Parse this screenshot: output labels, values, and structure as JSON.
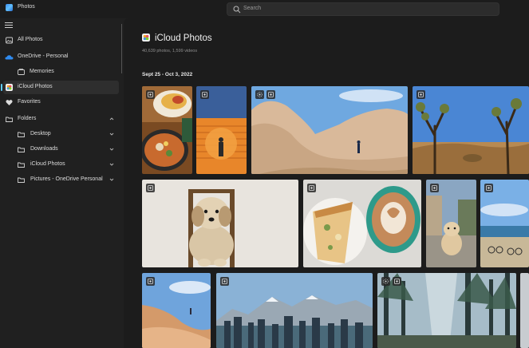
{
  "window": {
    "app_title": "Photos"
  },
  "search": {
    "placeholder": "Search"
  },
  "sidebar": {
    "all_photos": "All Photos",
    "onedrive": "OneDrive - Personal",
    "memories": "Memories",
    "icloud": "iCloud Photos",
    "favorites": "Favorites",
    "folders": "Folders",
    "folder_items": [
      "Desktop",
      "Downloads",
      "iCloud Photos",
      "Pictures - OneDrive Personal"
    ]
  },
  "main": {
    "title": "iCloud Photos",
    "subtitle": "40,639 photos, 1,599 videos",
    "date_range": "Sept 25 - Oct 3, 2022"
  },
  "colors": {
    "accent": "#60cdff",
    "background": "#202020",
    "panel": "#1c1c1c"
  }
}
